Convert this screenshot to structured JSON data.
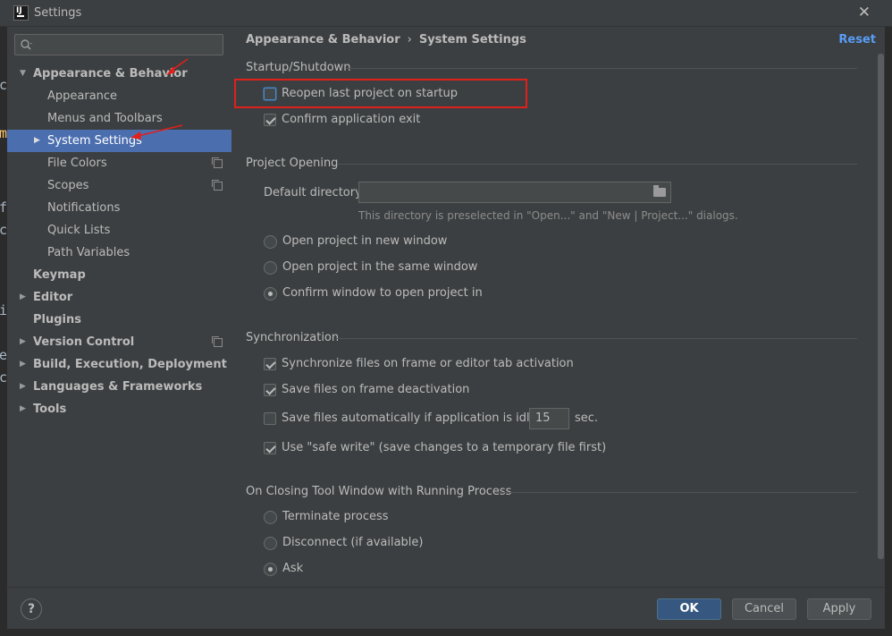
{
  "window": {
    "title": "Settings"
  },
  "left_strip_glyphs": [
    "c",
    "m",
    "f",
    "c",
    "i",
    "e",
    "c"
  ],
  "search": {
    "placeholder": ""
  },
  "sidebar": {
    "items": [
      {
        "label": "Appearance & Behavior",
        "expanded": true,
        "bold": true
      },
      {
        "label": "Appearance"
      },
      {
        "label": "Menus and Toolbars"
      },
      {
        "label": "System Settings",
        "selected": true,
        "collapsed": true
      },
      {
        "label": "File Colors",
        "icon": "copy-icon"
      },
      {
        "label": "Scopes",
        "icon": "copy-icon"
      },
      {
        "label": "Notifications"
      },
      {
        "label": "Quick Lists"
      },
      {
        "label": "Path Variables"
      },
      {
        "label": "Keymap",
        "bold": true
      },
      {
        "label": "Editor",
        "bold": true,
        "collapsed": true
      },
      {
        "label": "Plugins",
        "bold": true
      },
      {
        "label": "Version Control",
        "bold": true,
        "collapsed": true,
        "icon": "copy-icon"
      },
      {
        "label": "Build, Execution, Deployment",
        "bold": true,
        "collapsed": true
      },
      {
        "label": "Languages & Frameworks",
        "bold": true,
        "collapsed": true
      },
      {
        "label": "Tools",
        "bold": true,
        "collapsed": true
      }
    ]
  },
  "breadcrumb": {
    "parent": "Appearance & Behavior",
    "separator": "›",
    "current": "System Settings"
  },
  "reset_label": "Reset",
  "startup": {
    "title": "Startup/Shutdown",
    "reopen_label": "Reopen last project on startup",
    "reopen_checked": false,
    "confirm_exit_label": "Confirm application exit",
    "confirm_exit_checked": true
  },
  "project_opening": {
    "title": "Project Opening",
    "default_dir_label": "Default directory:",
    "default_dir_value": "",
    "hint": "This directory is preselected in \"Open...\" and \"New | Project...\" dialogs.",
    "options": [
      "Open project in new window",
      "Open project in the same window",
      "Confirm window to open project in"
    ],
    "selected_index": 2
  },
  "sync": {
    "title": "Synchronization",
    "sync_files_label": "Synchronize files on frame or editor tab activation",
    "save_deactivation_label": "Save files on frame deactivation",
    "save_idle_label": "Save files automatically if application is idle for",
    "idle_seconds": "15",
    "sec_label": "sec.",
    "safe_write_label": "Use \"safe write\" (save changes to a temporary file first)",
    "checked": [
      true,
      true,
      false,
      true
    ]
  },
  "closing": {
    "title": "On Closing Tool Window with Running Process",
    "options": [
      "Terminate process",
      "Disconnect (if available)",
      "Ask"
    ],
    "selected_index": 2
  },
  "footer": {
    "help": "?",
    "ok": "OK",
    "cancel": "Cancel",
    "apply": "Apply"
  },
  "colors": {
    "accent": "#4b6eaf",
    "primary_button": "#365880",
    "link": "#589df6",
    "annotation": "#e0201a"
  }
}
